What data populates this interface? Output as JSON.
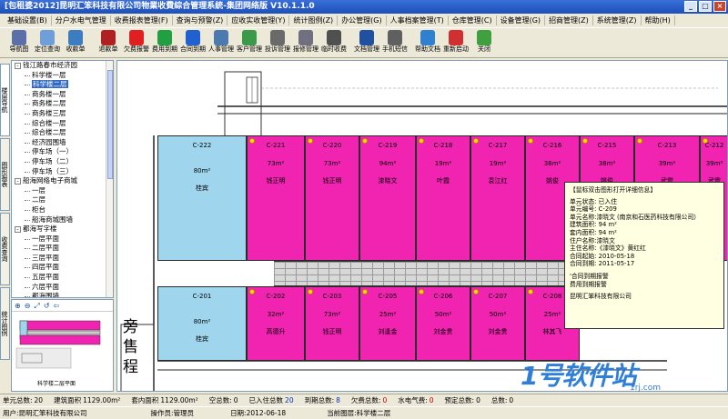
{
  "window": {
    "title": "[包租婆2012]昆明汇笨科技有限公司物業收費綜合管理系統-集团网络版 V10.1.1.0"
  },
  "menu": [
    {
      "label": "基础设置(B)"
    },
    {
      "label": "分户水电气管理"
    },
    {
      "label": "收费报表管理(F)"
    },
    {
      "label": "查询与预警(Z)"
    },
    {
      "label": "应收实收管理(Y)"
    },
    {
      "label": "统计图例(Z)"
    },
    {
      "label": "办公管理(G)"
    },
    {
      "label": "人事档案管理(T)"
    },
    {
      "label": "仓库管理(C)"
    },
    {
      "label": "设备管理(G)"
    },
    {
      "label": "招商管理(Z)"
    },
    {
      "label": "系统管理(Z)"
    },
    {
      "label": "帮助(H)"
    }
  ],
  "toolbar": [
    {
      "label": "导航图",
      "icon": "org-chart-icon",
      "color": "#5b6fa8"
    },
    {
      "label": "定位查询",
      "icon": "magnifier-icon",
      "color": "#6f9fd8"
    },
    {
      "label": "收款单",
      "icon": "receipt-icon",
      "color": "#3c7cc0"
    },
    {
      "label": "退款单",
      "icon": "refund-icon",
      "color": "#b02020"
    },
    {
      "label": "欠费报警",
      "icon": "alarm-red-icon",
      "color": "#e02020"
    },
    {
      "label": "费用到期",
      "icon": "alarm-green-icon",
      "color": "#20a040"
    },
    {
      "label": "合同到期",
      "icon": "alarm-blue-icon",
      "color": "#2060d0"
    },
    {
      "label": "人事管理",
      "icon": "person-icon",
      "color": "#4a7ab0"
    },
    {
      "label": "客户管理",
      "icon": "customers-icon",
      "color": "#3a9a4a"
    },
    {
      "label": "投诉管理",
      "icon": "complaint-icon",
      "color": "#6a6a6a"
    },
    {
      "label": "报修管理",
      "icon": "repair-icon",
      "color": "#707080"
    },
    {
      "label": "临时收费",
      "icon": "clock-icon",
      "color": "#505050"
    },
    {
      "label": "文档管理",
      "icon": "books-icon",
      "color": "#2050a0"
    },
    {
      "label": "手机短信",
      "icon": "fax-icon",
      "color": "#606060"
    },
    {
      "label": "帮助文档",
      "icon": "help-icon",
      "color": "#3080d0"
    },
    {
      "label": "重新启动",
      "icon": "restart-icon",
      "color": "#d03030"
    },
    {
      "label": "关闭",
      "icon": "exit-icon",
      "color": "#40a040"
    }
  ],
  "side_tabs": [
    {
      "label": "楼层导航"
    },
    {
      "label": "图形报表"
    },
    {
      "label": "收费查询"
    },
    {
      "label": "统计图例"
    }
  ],
  "tree": [
    {
      "label": "钱江路春市经济园",
      "level": 0,
      "toggle": "-"
    },
    {
      "label": "科学楼一层",
      "level": 1
    },
    {
      "label": "科学楼二层",
      "level": 1,
      "selected": true
    },
    {
      "label": "商务楼一层",
      "level": 1
    },
    {
      "label": "商务楼二层",
      "level": 1
    },
    {
      "label": "商务楼三层",
      "level": 1
    },
    {
      "label": "综合楼一层",
      "level": 1
    },
    {
      "label": "综合楼二层",
      "level": 1
    },
    {
      "label": "经济园围墙",
      "level": 1
    },
    {
      "label": "停车场（一）",
      "level": 1
    },
    {
      "label": "停车场（二）",
      "level": 1
    },
    {
      "label": "停车场（三）",
      "level": 1
    },
    {
      "label": "船海网络电子商城",
      "level": 0,
      "toggle": "-"
    },
    {
      "label": "一层",
      "level": 1
    },
    {
      "label": "二层",
      "level": 1
    },
    {
      "label": "柜台",
      "level": 1
    },
    {
      "label": "船海商城围墙",
      "level": 1
    },
    {
      "label": "都海写字楼",
      "level": 0,
      "toggle": "-"
    },
    {
      "label": "一层平面",
      "level": 1
    },
    {
      "label": "二层平面",
      "level": 1
    },
    {
      "label": "三层平面",
      "level": 1
    },
    {
      "label": "四层平面",
      "level": 1
    },
    {
      "label": "五层平面",
      "level": 1
    },
    {
      "label": "六层平面",
      "level": 1
    },
    {
      "label": "都海围墙",
      "level": 1
    },
    {
      "label": "大道大厦",
      "level": 0,
      "toggle": "-"
    },
    {
      "label": "一楼",
      "level": 1
    }
  ],
  "minimap": {
    "label": "科学楼二层平面",
    "tools": [
      "⊕",
      "⊖",
      "⤢",
      "↺",
      "⇦"
    ]
  },
  "units_top": [
    {
      "code": "C-222",
      "area": "80m²",
      "tenant": "桂宾",
      "status": "empty"
    },
    {
      "code": "C-221",
      "area": "73m²",
      "tenant": "钱正明",
      "status": "rented"
    },
    {
      "code": "C-220",
      "area": "73m²",
      "tenant": "钱正明",
      "status": "rented"
    },
    {
      "code": "C-219",
      "area": "94m²",
      "tenant": "漆晓文",
      "status": "rented"
    },
    {
      "code": "C-218",
      "area": "19m²",
      "tenant": "叶霞",
      "status": "rented"
    },
    {
      "code": "C-217",
      "area": "19m²",
      "tenant": "袁江红",
      "status": "rented"
    },
    {
      "code": "C-216",
      "area": "38m²",
      "tenant": "姚俊",
      "status": "rented"
    },
    {
      "code": "C-215",
      "area": "38m²",
      "tenant": "姚俊",
      "status": "rented"
    },
    {
      "code": "C-213",
      "area": "39m²",
      "tenant": "武震",
      "status": "rented"
    },
    {
      "code": "C-212",
      "area": "39m²",
      "tenant": "武震",
      "status": "rented"
    }
  ],
  "units_bottom": [
    {
      "code": "C-201",
      "area": "80m²",
      "tenant": "桂宾",
      "status": "empty"
    },
    {
      "code": "C-202",
      "area": "32m²",
      "tenant": "高德升",
      "status": "rented"
    },
    {
      "code": "C-203",
      "area": "73m²",
      "tenant": "钱正明",
      "status": "rented"
    },
    {
      "code": "C-205",
      "area": "25m²",
      "tenant": "刘逢金",
      "status": "rented"
    },
    {
      "code": "C-206",
      "area": "50m²",
      "tenant": "刘金贵",
      "status": "rented"
    },
    {
      "code": "C-207",
      "area": "50m²",
      "tenant": "刘金贵",
      "status": "rented"
    },
    {
      "code": "C-208",
      "area": "25m²",
      "tenant": "林其飞",
      "status": "rented"
    }
  ],
  "plan_text": {
    "stairs_label": "旁\n售\n程"
  },
  "popup": {
    "title": "【鼠标双击图形打开详细信息】",
    "lines": [
      "单元状态: 已入住",
      "单元编号: C-209",
      "单元名称:漆晓文 (南京和石医药科技有限公司）",
      "建筑面积: 94 m²",
      "套内面积: 94 m²",
      "住户名称:漆晓文",
      "主住名称:《漆晓文》黄红红",
      "合同起始: 2010-05-18",
      "合同到期: 2011-05-17"
    ],
    "lines2": [
      "'合同到期报警",
      "费用到期报警"
    ],
    "company": "昆明汇笨科技有限公司"
  },
  "watermark": {
    "big": "1号软件站",
    "small": "1rj.com"
  },
  "status1": [
    {
      "label": "单元总数:",
      "value": "20",
      "cls": ""
    },
    {
      "label": "建筑面积",
      "value": "1129.00m²",
      "cls": ""
    },
    {
      "label": "套内面积",
      "value": "1129.00m²",
      "cls": ""
    },
    {
      "label": "空总数:",
      "value": "0",
      "cls": ""
    },
    {
      "label": "已入住总数",
      "value": "20",
      "cls": "v-blue"
    },
    {
      "label": "到期总数:",
      "value": "8",
      "cls": "v-blue"
    },
    {
      "label": "欠费总数:",
      "value": "0",
      "cls": "v-red"
    },
    {
      "label": "水电气费:",
      "value": "0",
      "cls": "v-red"
    },
    {
      "label": "预定总数:",
      "value": "0",
      "cls": ""
    },
    {
      "label": "总数:",
      "value": "0",
      "cls": ""
    }
  ],
  "status2": [
    {
      "label": "用户:",
      "value": "昆明汇笨科技有限公司"
    },
    {
      "label": "操作员:",
      "value": "管理员"
    },
    {
      "label": "日期:",
      "value": "2012-06-18"
    },
    {
      "label": "当前图层:",
      "value": "科学楼二层"
    }
  ]
}
